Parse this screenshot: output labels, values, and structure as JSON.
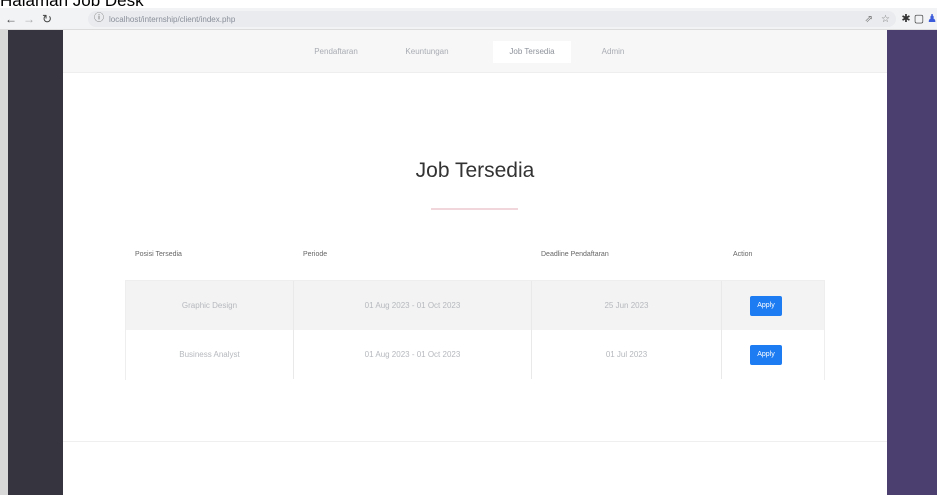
{
  "caption": "Halaman Job Desk",
  "browser": {
    "url": "localhost/internship/client/index.php",
    "back_icon": "back-arrow-icon",
    "forward_icon": "forward-arrow-icon",
    "reload_icon": "reload-icon"
  },
  "nav": {
    "items": [
      {
        "label": "Pendaftaran"
      },
      {
        "label": "Keuntungan"
      },
      {
        "label": "Job Tersedia"
      },
      {
        "label": "Admin"
      }
    ],
    "active_index": 2
  },
  "main": {
    "title": "Job Tersedia"
  },
  "table": {
    "headers": [
      "Posisi Tersedia",
      "Periode",
      "Deadline Pendaftaran",
      "Action"
    ],
    "rows": [
      {
        "posisi": "Graphic Design",
        "periode": "01 Aug 2023 - 01 Oct 2023",
        "deadline": "25 Jun 2023",
        "action": "Apply"
      },
      {
        "posisi": "Business Analyst",
        "periode": "01 Aug 2023 - 01 Oct 2023",
        "deadline": "01 Jul 2023",
        "action": "Apply"
      }
    ]
  },
  "colors": {
    "accent": "#1e7cf2",
    "title_underline": "#f1d7dc",
    "sidebar_left": "#36353f",
    "sidebar_right": "#4a3f6e"
  }
}
